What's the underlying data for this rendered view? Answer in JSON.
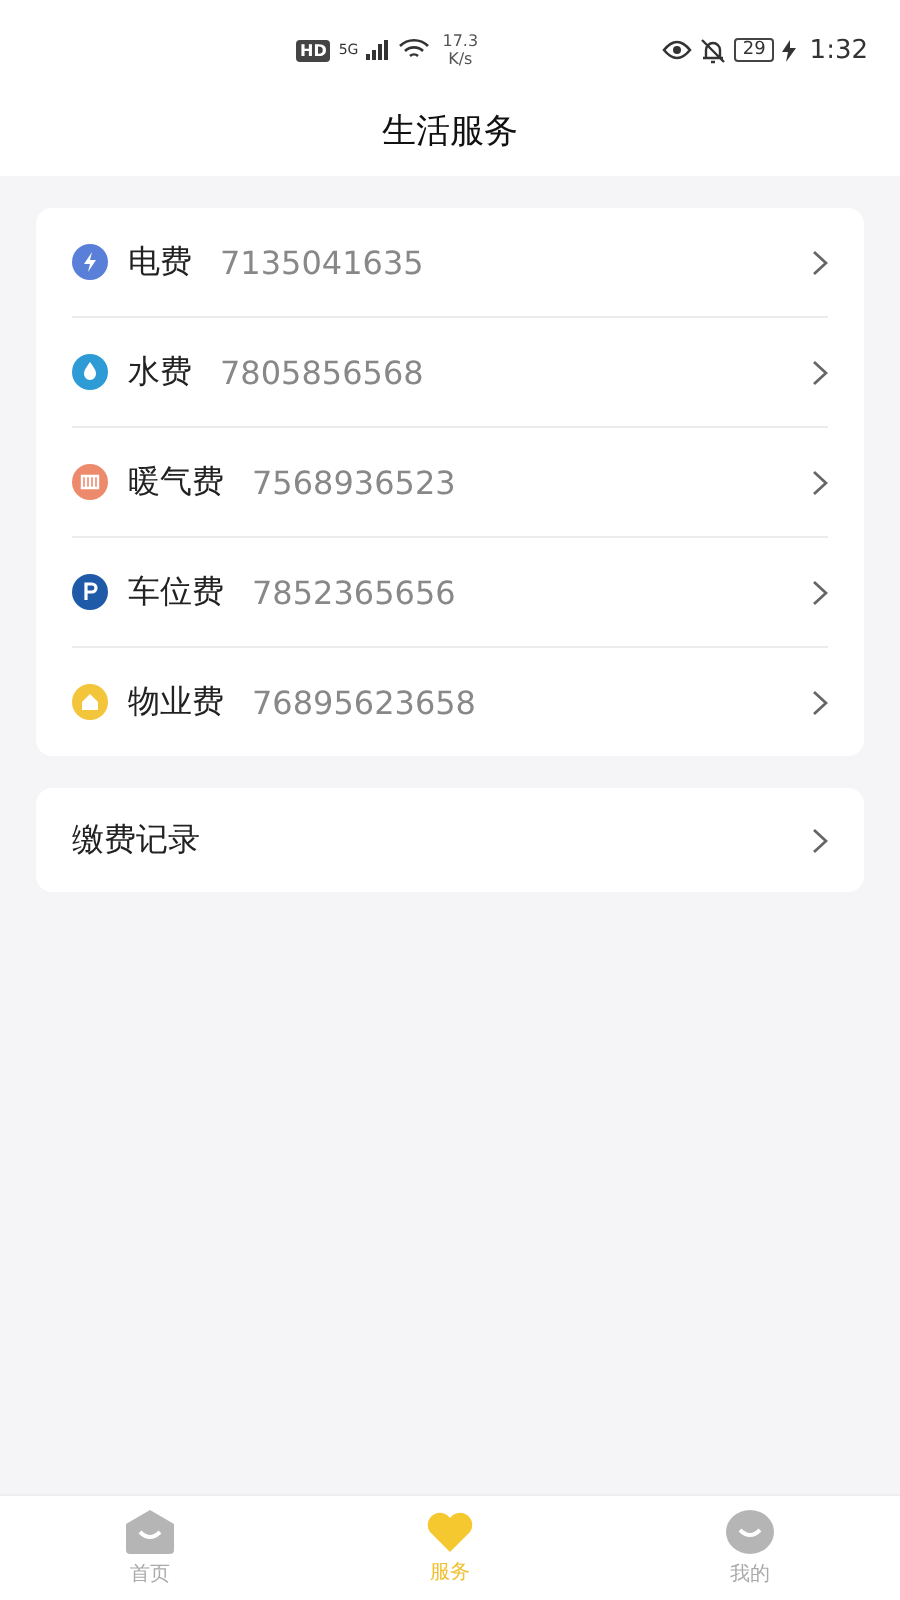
{
  "status_bar": {
    "network_badge": "HD",
    "network_type": "5G",
    "speed_value": "17.3",
    "speed_unit": "K/s",
    "battery": "29",
    "time": "1:32"
  },
  "title": "生活服务",
  "bills": [
    {
      "kind": "electric",
      "label": "电费",
      "account": "7135041635"
    },
    {
      "kind": "water",
      "label": "水费",
      "account": "7805856568"
    },
    {
      "kind": "heating",
      "label": "暖气费",
      "account": "7568936523"
    },
    {
      "kind": "parking",
      "label": "车位费",
      "account": "7852365656"
    },
    {
      "kind": "property",
      "label": "物业费",
      "account": "76895623658"
    }
  ],
  "history": {
    "label": "缴费记录"
  },
  "tab_bar": [
    {
      "kind": "home",
      "label": "首页",
      "selected": false
    },
    {
      "kind": "service",
      "label": "服务",
      "selected": true
    },
    {
      "kind": "profile",
      "label": "我的",
      "selected": false
    }
  ]
}
